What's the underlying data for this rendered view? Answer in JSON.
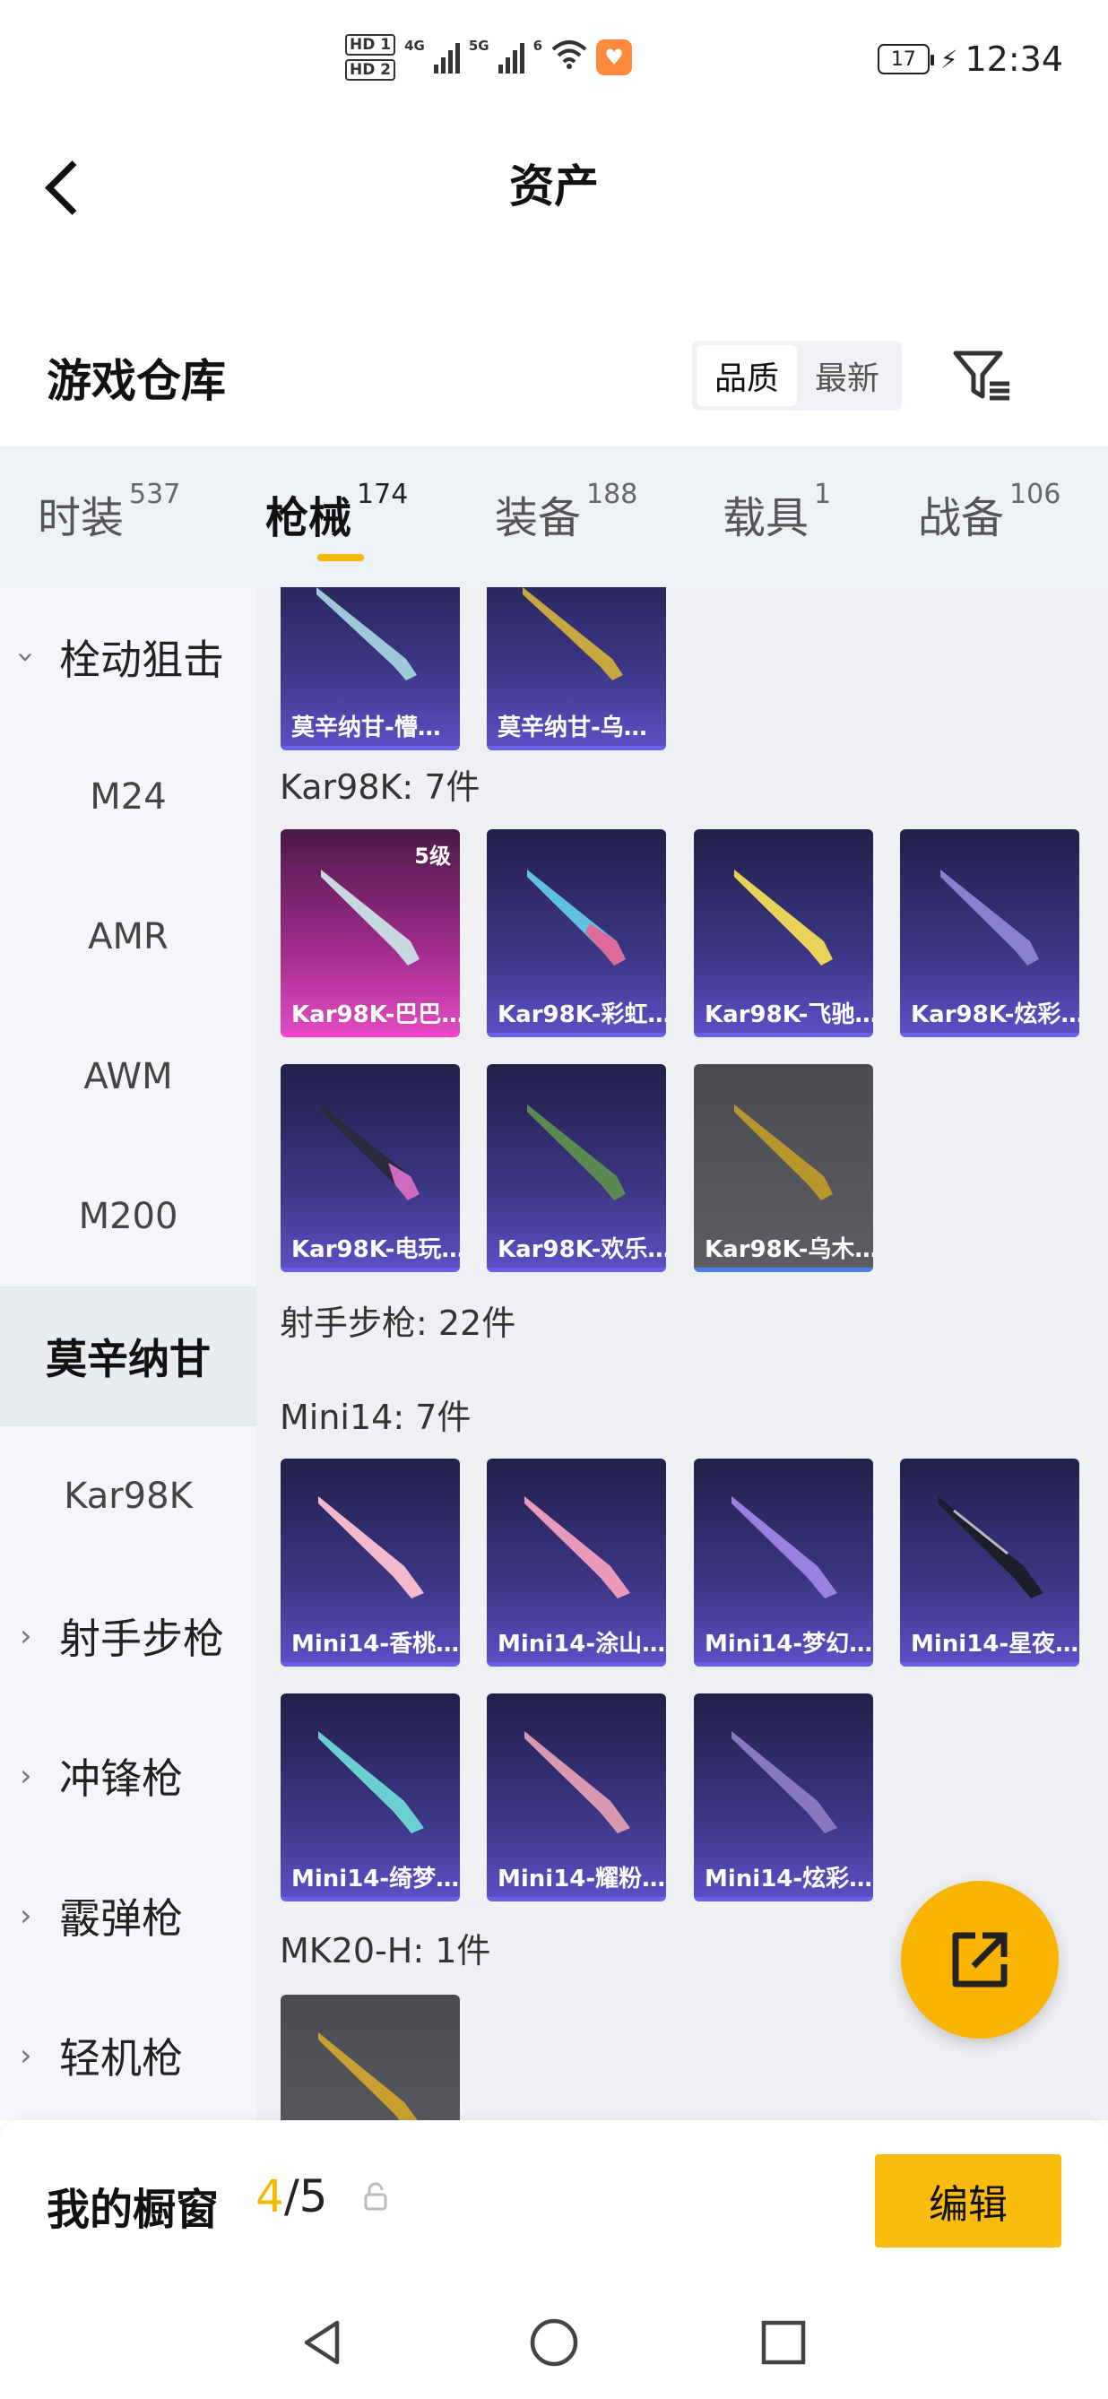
{
  "status_bar": {
    "hd1": "HD 1",
    "hd2": "HD 2",
    "net1": "4G",
    "net2": "5G",
    "wifi_label": "6",
    "battery": "17",
    "time": "12:34"
  },
  "header": {
    "title": "资产"
  },
  "warehouse": {
    "title": "游戏仓库",
    "sort_options": [
      "品质",
      "最新"
    ],
    "sort_active": "品质"
  },
  "tabs": [
    {
      "label": "时装",
      "count": "537",
      "active": false
    },
    {
      "label": "枪械",
      "count": "174",
      "active": true
    },
    {
      "label": "装备",
      "count": "188",
      "active": false
    },
    {
      "label": "载具",
      "count": "1",
      "active": false
    },
    {
      "label": "战备",
      "count": "106",
      "active": false
    }
  ],
  "sidebar": {
    "items": [
      {
        "label": "栓动狙击",
        "type": "group",
        "open": true
      },
      {
        "label": "M24",
        "type": "item"
      },
      {
        "label": "AMR",
        "type": "item"
      },
      {
        "label": "AWM",
        "type": "item"
      },
      {
        "label": "M200",
        "type": "item"
      },
      {
        "label": "莫辛纳甘",
        "type": "item",
        "selected": true
      },
      {
        "label": "Kar98K",
        "type": "item"
      },
      {
        "label": "射手步枪",
        "type": "group",
        "open": false
      },
      {
        "label": "冲锋枪",
        "type": "group",
        "open": false
      },
      {
        "label": "霰弹枪",
        "type": "group",
        "open": false
      },
      {
        "label": "轻机枪",
        "type": "group",
        "open": false
      }
    ]
  },
  "content": {
    "mosin_cards": [
      {
        "name": "莫辛纳甘-懵…",
        "style": "purple"
      },
      {
        "name": "莫辛纳甘-乌…",
        "style": "purple"
      }
    ],
    "kar98k": {
      "label": "Kar98K: 7件",
      "cards": [
        {
          "name": "Kar98K-巴巴…",
          "style": "pink",
          "badge": "5级"
        },
        {
          "name": "Kar98K-彩虹…",
          "style": "purple"
        },
        {
          "name": "Kar98K-飞驰…",
          "style": "purple"
        },
        {
          "name": "Kar98K-炫彩…",
          "style": "purple"
        },
        {
          "name": "Kar98K-电玩…",
          "style": "purple"
        },
        {
          "name": "Kar98K-欢乐…",
          "style": "purple"
        },
        {
          "name": "Kar98K-乌木…",
          "style": "grey"
        }
      ]
    },
    "marksman": {
      "label": "射手步枪: 22件"
    },
    "mini14": {
      "label": "Mini14: 7件",
      "cards": [
        {
          "name": "Mini14-香桃…",
          "style": "purple"
        },
        {
          "name": "Mini14-涂山…",
          "style": "purple"
        },
        {
          "name": "Mini14-梦幻…",
          "style": "purple"
        },
        {
          "name": "Mini14-星夜…",
          "style": "purple"
        },
        {
          "name": "Mini14-绮梦…",
          "style": "purple"
        },
        {
          "name": "Mini14-耀粉…",
          "style": "purple"
        },
        {
          "name": "Mini14-炫彩…",
          "style": "purple"
        }
      ]
    },
    "mk20": {
      "label": "MK20-H: 1件",
      "cards": [
        {
          "name": "",
          "style": "grey"
        }
      ]
    }
  },
  "bottom_bar": {
    "title": "我的橱窗",
    "count_current": "4",
    "count_total": "/5",
    "edit_label": "编辑"
  },
  "colors": {
    "accent": "#f9bc0c",
    "tab_bg": "#eef2f7",
    "card_purple": "#3c3583",
    "card_pink": "#e04bc0",
    "card_grey": "#5c5e64"
  },
  "icons": {
    "back": "chevron-left-icon",
    "filter": "filter-icon",
    "fab": "share-external-icon",
    "lock": "lock-icon",
    "nav": [
      "back-triangle-icon",
      "home-circle-icon",
      "recents-square-icon"
    ]
  }
}
